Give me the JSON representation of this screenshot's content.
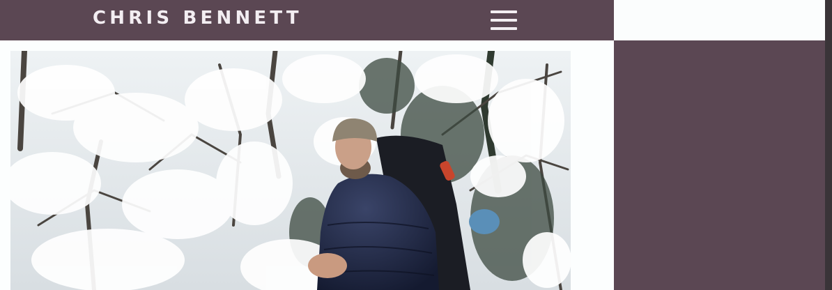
{
  "header": {
    "site_title": "CHRIS BENNETT",
    "menu_icon": "hamburger-menu-icon"
  },
  "colors": {
    "brand": "#5b4753",
    "header_text": "#f3eef2",
    "page_background": "#fcfefe"
  },
  "hero_image": {
    "subject": "hiker-in-snowy-forest"
  }
}
